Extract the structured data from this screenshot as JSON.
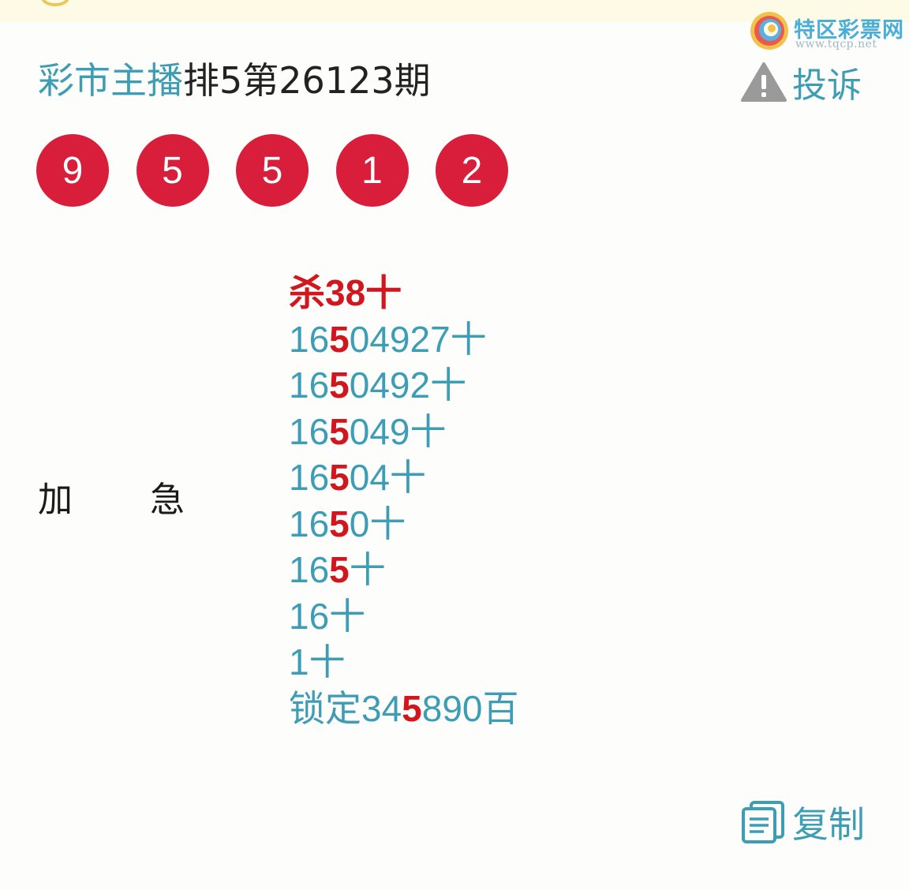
{
  "watermark": {
    "name": "特区彩票网",
    "url": "www.tqcp.net"
  },
  "header": {
    "author": "彩市主播",
    "issue": "排5第26123期",
    "complain_label": "投诉",
    "complain_icon": "warning-icon"
  },
  "draw_numbers": [
    "9",
    "5",
    "5",
    "1",
    "2"
  ],
  "side_labels": [
    "加",
    "急"
  ],
  "prediction": {
    "kill_line": "杀38十",
    "lines": [
      {
        "pre": "16",
        "hl": "5",
        "post": "04927十"
      },
      {
        "pre": "16",
        "hl": "5",
        "post": "0492十"
      },
      {
        "pre": "16",
        "hl": "5",
        "post": "049十"
      },
      {
        "pre": "16",
        "hl": "5",
        "post": "04十"
      },
      {
        "pre": "16",
        "hl": "5",
        "post": "0十"
      },
      {
        "pre": "16",
        "hl": "5",
        "post": "十"
      },
      {
        "pre": "16十",
        "hl": "",
        "post": ""
      },
      {
        "pre": "1十",
        "hl": "",
        "post": ""
      },
      {
        "pre": "锁定34",
        "hl": "5",
        "post": "890百"
      }
    ]
  },
  "copy": {
    "label": "复制",
    "icon": "copy-document-icon"
  },
  "colors": {
    "accent": "#3d9db4",
    "ball": "#d81e3a",
    "highlight": "#d2161e",
    "background": "#fdfdfb"
  }
}
